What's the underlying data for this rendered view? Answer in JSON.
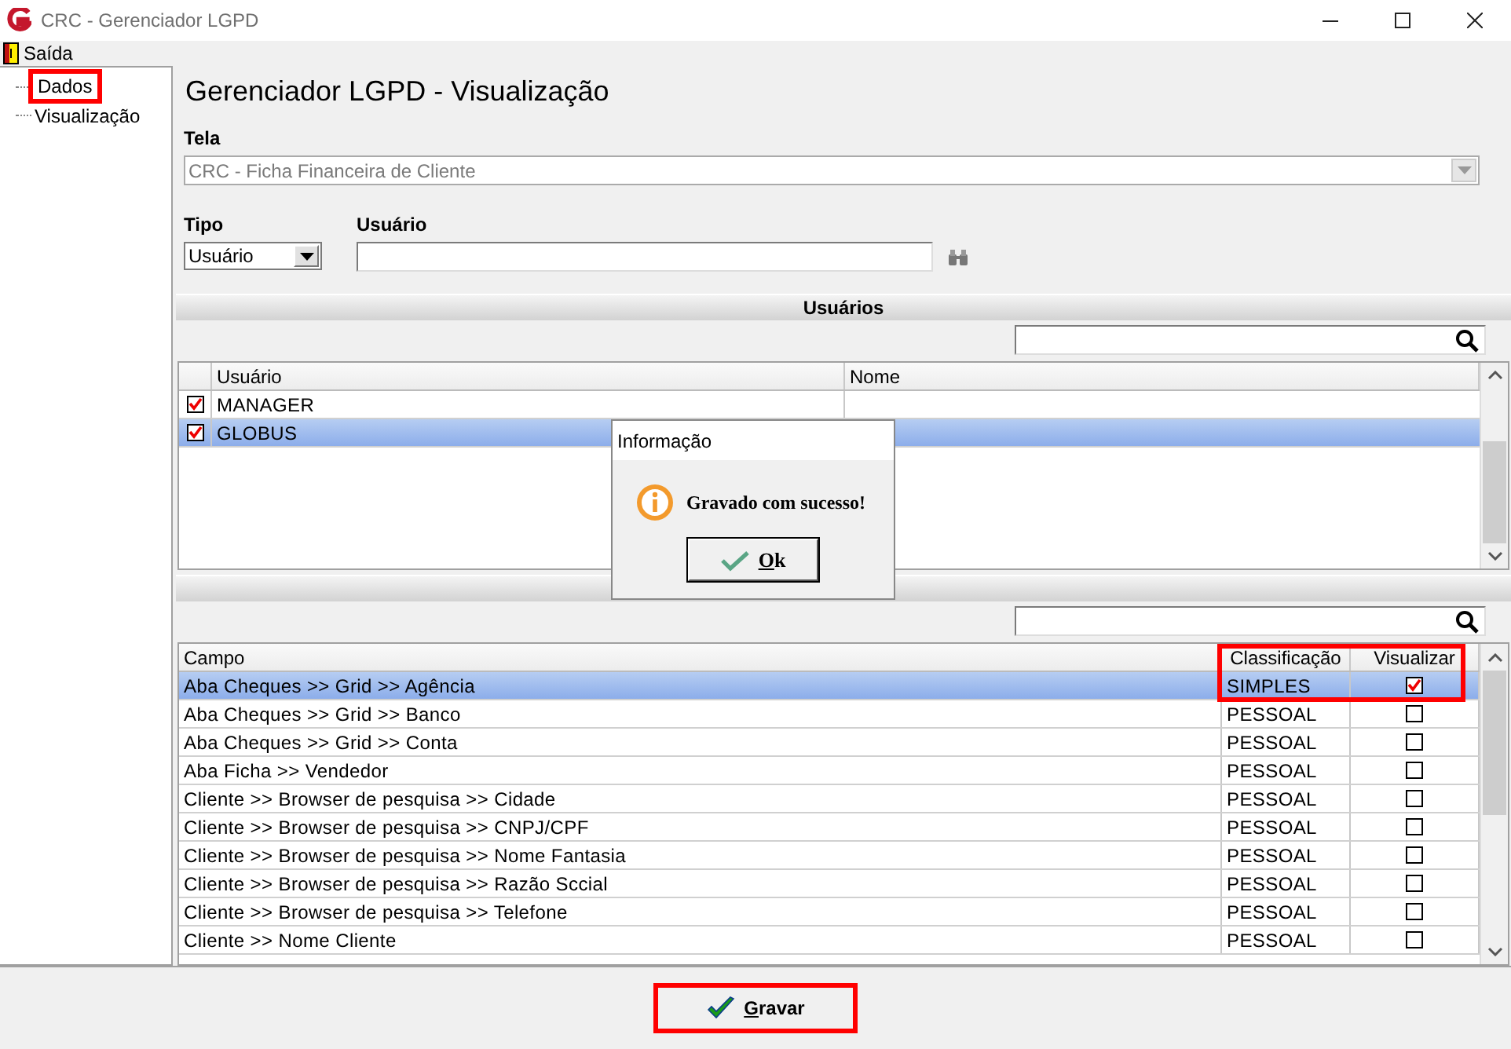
{
  "window": {
    "title": "CRC - Gerenciador LGPD"
  },
  "menu": [
    {
      "label": "Saída"
    }
  ],
  "sidebar": {
    "items": [
      {
        "label": "Dados",
        "highlighted": true
      },
      {
        "label": "Visualização",
        "highlighted": false
      }
    ]
  },
  "page_title": "Gerenciador LGPD - Visualização",
  "tela": {
    "label": "Tela",
    "value": "CRC - Ficha Financeira de Cliente",
    "disabled": true
  },
  "tipo": {
    "label": "Tipo",
    "value": "Usuário"
  },
  "usuario": {
    "label": "Usuário"
  },
  "users_section": {
    "title": "Usuários",
    "columns": [
      "Usuário",
      "Nome"
    ],
    "rows": [
      {
        "usuario": "MANAGER",
        "checked": true,
        "selected": false
      },
      {
        "usuario": "GLOBUS",
        "checked": true,
        "selected": true
      }
    ]
  },
  "fields_section": {
    "columns": [
      "Campo",
      "Classificação",
      "Visualizar"
    ],
    "highlighted": true,
    "rows": [
      {
        "campo": "Aba Cheques >> Grid >> Agência",
        "classificacao": "SIMPLES",
        "visualizar": true,
        "selected": true
      },
      {
        "campo": "Aba Cheques >> Grid >> Banco",
        "classificacao": "PESSOAL",
        "visualizar": false,
        "selected": false
      },
      {
        "campo": "Aba Cheques >> Grid >> Conta",
        "classificacao": "PESSOAL",
        "visualizar": false,
        "selected": false
      },
      {
        "campo": "Aba Ficha >> Vendedor",
        "classificacao": "PESSOAL",
        "visualizar": false,
        "selected": false
      },
      {
        "campo": "Cliente >> Browser de pesquisa >> Cidade",
        "classificacao": "PESSOAL",
        "visualizar": false,
        "selected": false
      },
      {
        "campo": "Cliente >> Browser de pesquisa >> CNPJ/CPF",
        "classificacao": "PESSOAL",
        "visualizar": false,
        "selected": false
      },
      {
        "campo": "Cliente >> Browser de pesquisa >> Nome Fantasia",
        "classificacao": "PESSOAL",
        "visualizar": false,
        "selected": false
      },
      {
        "campo": "Cliente >> Browser de pesquisa >> Razão Sccial",
        "classificacao": "PESSOAL",
        "visualizar": false,
        "selected": false
      },
      {
        "campo": "Cliente >> Browser de pesquisa >> Telefone",
        "classificacao": "PESSOAL",
        "visualizar": false,
        "selected": false
      },
      {
        "campo": "Cliente >> Nome Cliente",
        "classificacao": "PESSOAL",
        "visualizar": false,
        "selected": false
      }
    ]
  },
  "dialog": {
    "title": "Informação",
    "message": "Gravado com sucesso!",
    "button": "Ok"
  },
  "save_button": {
    "label": "Gravar",
    "highlighted": true
  }
}
